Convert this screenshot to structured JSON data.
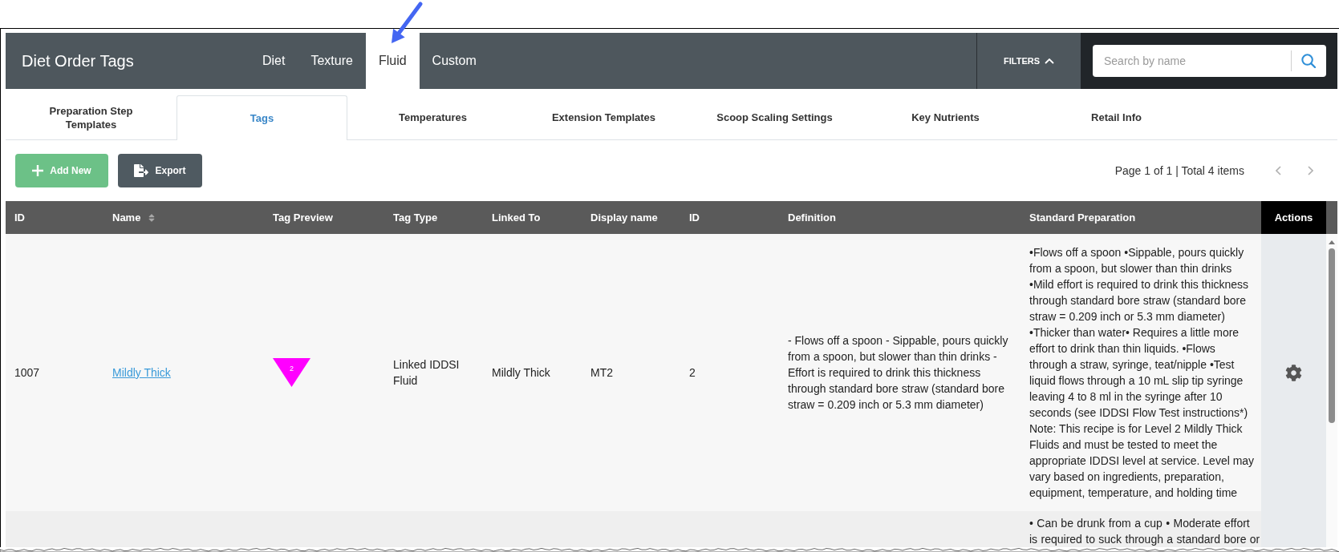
{
  "app_header": {
    "title": "Diet Order Tags",
    "tabs": [
      {
        "label": "Diet",
        "selected": false
      },
      {
        "label": "Texture",
        "selected": false
      },
      {
        "label": "Fluid",
        "selected": true
      },
      {
        "label": "Custom",
        "selected": false
      }
    ],
    "filters": {
      "label": "FILTERS",
      "expanded": true
    },
    "search": {
      "placeholder": "Search by name"
    }
  },
  "section_tabs": [
    {
      "label": "Preparation Step Templates",
      "selected": false
    },
    {
      "label": "Tags",
      "selected": true
    },
    {
      "label": "Temperatures",
      "selected": false
    },
    {
      "label": "Extension Templates",
      "selected": false
    },
    {
      "label": "Scoop Scaling Settings",
      "selected": false
    },
    {
      "label": "Key Nutrients",
      "selected": false
    },
    {
      "label": "Retail Info",
      "selected": false
    }
  ],
  "toolbar": {
    "buttons": [
      {
        "kind": "add",
        "label": "Add New"
      },
      {
        "kind": "export",
        "label": "Export"
      }
    ],
    "pagination": "Page 1 of 1 | Total 4 items"
  },
  "table": {
    "columns": [
      {
        "label": "ID",
        "sortable": false
      },
      {
        "label": "Name",
        "sortable": true
      },
      {
        "label": "Tag Preview",
        "sortable": false
      },
      {
        "label": "Tag Type",
        "sortable": false
      },
      {
        "label": "Linked To",
        "sortable": false
      },
      {
        "label": "Display name",
        "sortable": false
      },
      {
        "label": "ID",
        "sortable": false
      },
      {
        "label": "Definition",
        "sortable": false
      },
      {
        "label": "Standard Preparation",
        "sortable": false
      },
      {
        "label": "Actions",
        "sortable": false
      }
    ],
    "rows": [
      {
        "id": "1007",
        "name": "Mildly Thick",
        "tag_preview": {
          "label": "2",
          "color": "#ff00ff"
        },
        "tag_type": "Linked IDDSI Fluid",
        "linked_to": "Mildly Thick",
        "display_name": "MT2",
        "id_2": "2",
        "definition": "- Flows off a spoon - Sippable, pours quickly from a spoon, but slower than thin drinks - Effort is required to drink this thickness through standard bore straw (standard bore straw = 0.209 inch or 5.3 mm diameter)",
        "standard_preparation": [
          "•Flows off a spoon •Sippable, pours quickly from a spoon, but slower than thin drinks",
          "•Mild effort is required to drink this thickness through standard bore straw (standard bore straw = 0.209 inch or 5.3 mm diameter)",
          "•Thicker than water• Requires a little more effort to drink than thin liquids. •Flows through a straw, syringe, teat/nipple •Test liquid flows through a 10 mL slip tip syringe leaving 4 to 8 ml in the syringe after 10 seconds (see IDDSI Flow Test instructions*)",
          "Note: This recipe is for Level 2 Mildly Thick Fluids and must be tested to meet the appropriate IDDSI level at service. Level may vary based on ingredients, preparation, equipment, temperature, and holding time"
        ],
        "actions": [
          {
            "kind": "settings"
          }
        ]
      },
      {
        "standard_preparation": [
          "• Can be drunk from a cup • Moderate effort is required to suck through a standard bore or"
        ]
      }
    ]
  }
}
